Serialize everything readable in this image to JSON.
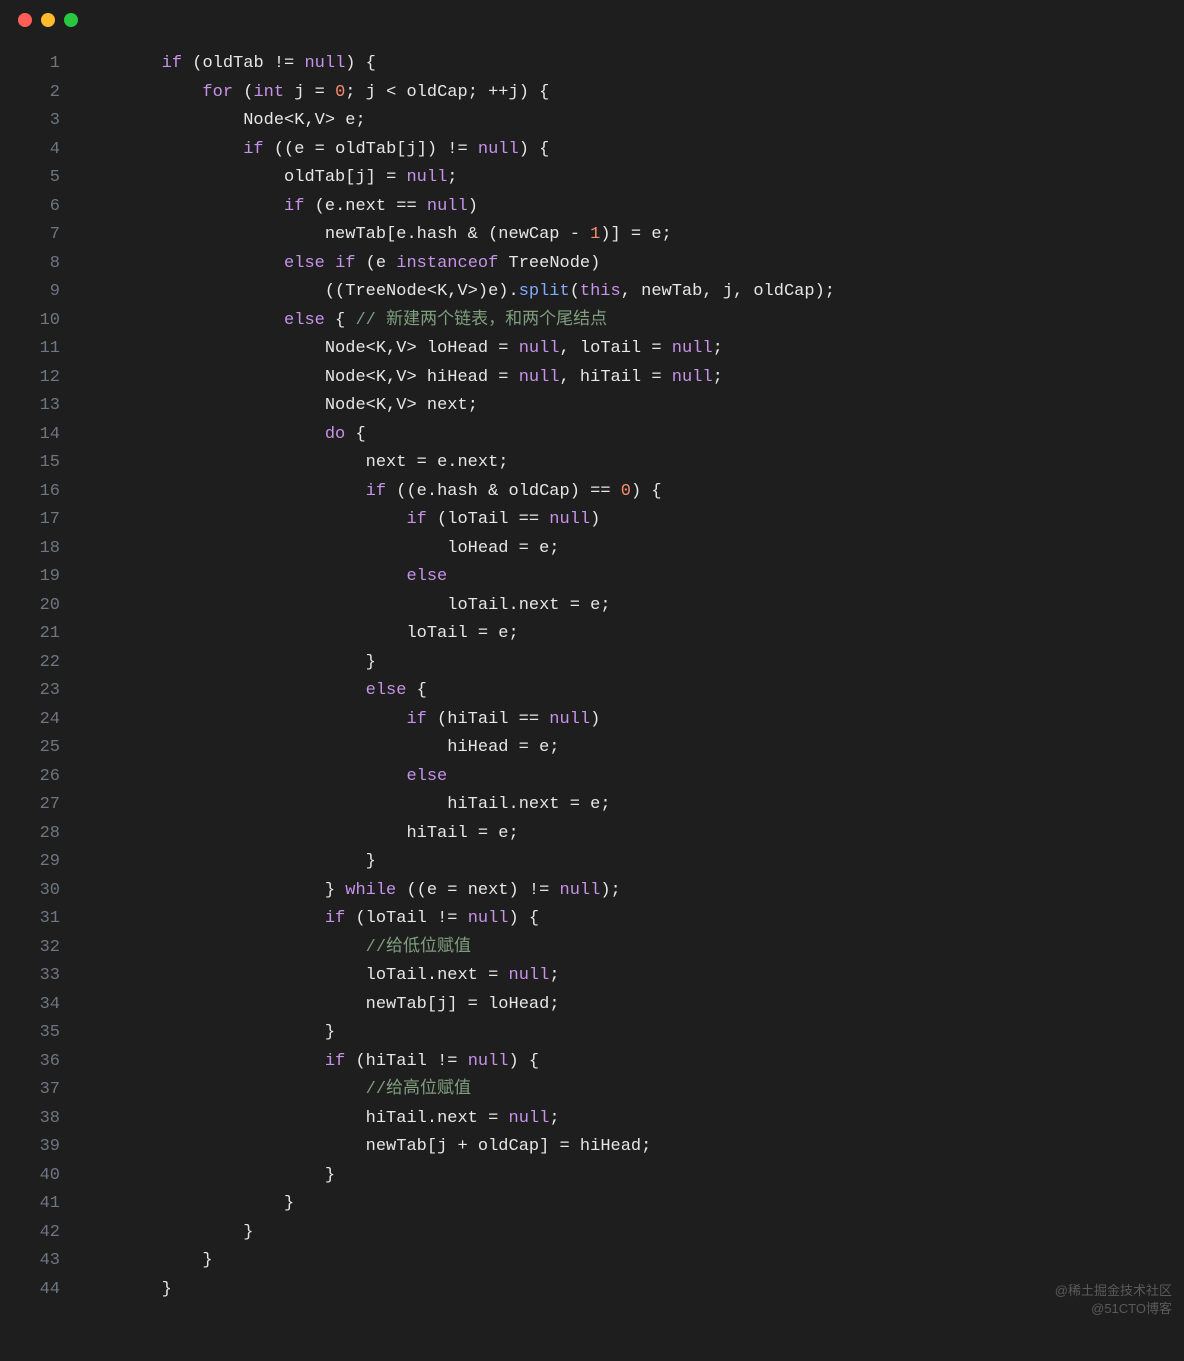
{
  "window": {
    "buttons": {
      "close": "#ff5f57",
      "min": "#febb2c",
      "max": "#28c840"
    }
  },
  "watermark": {
    "line1": "@稀土掘金技术社区",
    "line2": "@51CTO博客"
  },
  "gutter": [
    "1",
    "2",
    "3",
    "4",
    "5",
    "6",
    "7",
    "8",
    "9",
    "10",
    "11",
    "12",
    "13",
    "14",
    "15",
    "16",
    "17",
    "18",
    "19",
    "20",
    "21",
    "22",
    "23",
    "24",
    "25",
    "26",
    "27",
    "28",
    "29",
    "30",
    "31",
    "32",
    "33",
    "34",
    "35",
    "36",
    "37",
    "38",
    "39",
    "40",
    "41",
    "42",
    "43",
    "44"
  ],
  "code": {
    "tokens": {
      "kw_if": "if",
      "kw_for": "for",
      "kw_int": "int",
      "kw_else": "else",
      "kw_do": "do",
      "kw_while": "while",
      "kw_instanceof": "instanceof",
      "kw_this": "this",
      "lit_null": "null",
      "num_0": "0",
      "num_1": "1",
      "id_oldTab": "oldTab",
      "id_newTab": "newTab",
      "id_oldCap": "oldCap",
      "id_newCap": "newCap",
      "id_j": "j",
      "id_e": "e",
      "id_next": "next",
      "id_hash": "hash",
      "id_split": "split",
      "id_NodeKV": "Node<K,V>",
      "id_TreeNode": "TreeNode",
      "id_TreeNodeKV": "TreeNode<K,V>",
      "id_loHead": "loHead",
      "id_loTail": "loTail",
      "id_hiHead": "hiHead",
      "id_hiTail": "hiTail"
    },
    "comments": {
      "c1": "// 新建两个链表，和两个尾结点",
      "c2": "//给低位赋值",
      "c3": "//给高位赋值"
    }
  }
}
